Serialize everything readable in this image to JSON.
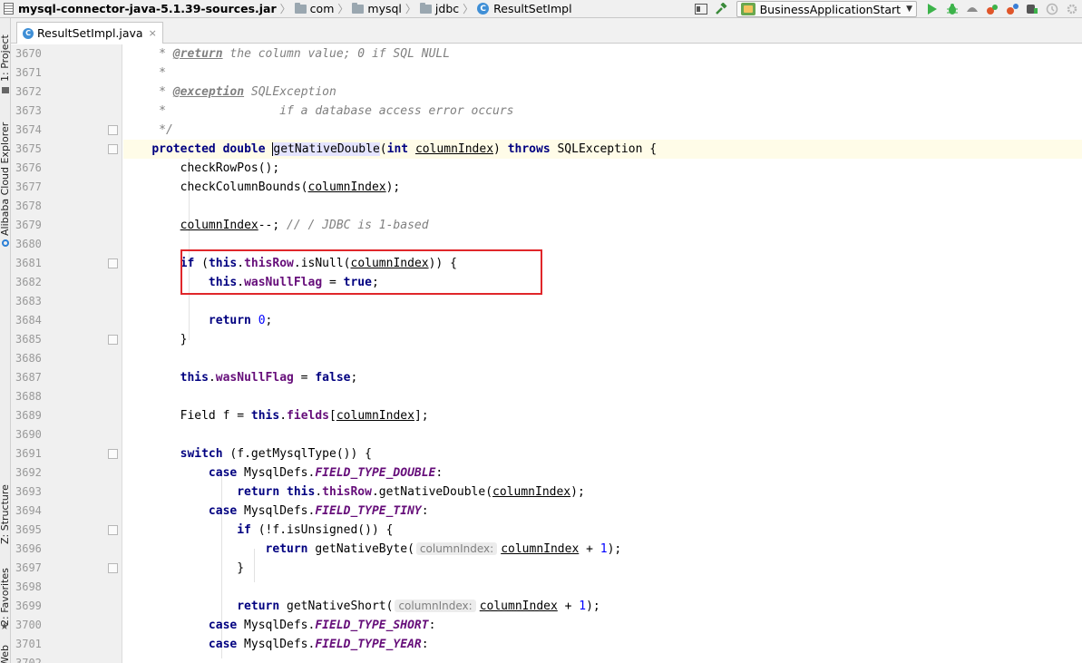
{
  "breadcrumb": {
    "jar": "mysql-connector-java-5.1.39-sources.jar",
    "folders": [
      "com",
      "mysql",
      "jdbc"
    ],
    "class_name": "ResultSetImpl"
  },
  "toolbar": {
    "run_config": "BusinessApplicationStart",
    "icons": [
      "layout-icon",
      "build-hammer-icon",
      "run-icon",
      "debug-icon",
      "coverage-icon",
      "profile-icon",
      "attach-icon",
      "stop-icon",
      "update-icon",
      "settings-icon"
    ]
  },
  "left_tool_windows": [
    "1: Project",
    "Alibaba Cloud Explorer",
    "Z: Structure",
    "2: Favorites",
    "Web"
  ],
  "editor": {
    "tab_label": "ResultSetImpl.java",
    "tab_close": "×",
    "line_numbers": [
      "3670",
      "3671",
      "3672",
      "3673",
      "3674",
      "3675",
      "3676",
      "3677",
      "3678",
      "3679",
      "3680",
      "3681",
      "3682",
      "3683",
      "3684",
      "3685",
      "3686",
      "3687",
      "3688",
      "3689",
      "3690",
      "3691",
      "3692",
      "3693",
      "3694",
      "3695",
      "3696",
      "3697",
      "3698",
      "3699",
      "3700",
      "3701",
      "3702"
    ],
    "code": {
      "l3670_star": "     * ",
      "l3670_tag": "@return",
      "l3670_rest": " the column value; 0 if SQL NULL",
      "l3671": "     *",
      "l3672_star": "     * ",
      "l3672_tag": "@exception",
      "l3672_type": " SQLException",
      "l3673": "     *                if a database access error occurs",
      "l3674": "     */",
      "l3675_kw1": "protected",
      "l3675_kw2": "double",
      "l3675_method": "getNativeDouble",
      "l3675_paren": "(",
      "l3675_kw3": "int",
      "l3675_param": "columnIndex",
      "l3675_close": ") ",
      "l3675_kw4": "throws",
      "l3675_rest": " SQLException {",
      "l3676": "checkRowPos();",
      "l3677_a": "checkColumnBounds(",
      "l3677_b": "columnIndex",
      "l3677_c": ");",
      "l3679_a": "columnIndex",
      "l3679_b": "--; ",
      "l3679_c": "// / JDBC is 1-based",
      "l3681_kw1": "if",
      "l3681_a": " (",
      "l3681_kw2": "this",
      "l3681_dot": ".",
      "l3681_field": "thisRow",
      "l3681_b": ".isNull(",
      "l3681_param": "columnIndex",
      "l3681_c": ")) {",
      "l3682_kw1": "this",
      "l3682_dot": ".",
      "l3682_field": "wasNullFlag",
      "l3682_a": " = ",
      "l3682_kw2": "true",
      "l3682_b": ";",
      "l3684_kw": "return",
      "l3684_num": "0",
      "l3684_b": ";",
      "l3685": "}",
      "l3687_kw1": "this",
      "l3687_dot": ".",
      "l3687_field": "wasNullFlag",
      "l3687_a": " = ",
      "l3687_kw2": "false",
      "l3687_b": ";",
      "l3689_a": "Field f = ",
      "l3689_kw": "this",
      "l3689_dot": ".",
      "l3689_field": "fields",
      "l3689_b": "[",
      "l3689_param": "columnIndex",
      "l3689_c": "];",
      "l3691_kw": "switch",
      "l3691_a": " (f.getMysqlType()) {",
      "l3692_kw": "case",
      "l3692_a": " MysqlDefs.",
      "l3692_const": "FIELD_TYPE_DOUBLE",
      "l3692_b": ":",
      "l3693_kw1": "return",
      "l3693_kw2": "this",
      "l3693_dot": ".",
      "l3693_field": "thisRow",
      "l3693_a": ".getNativeDouble(",
      "l3693_param": "columnIndex",
      "l3693_b": ");",
      "l3694_kw": "case",
      "l3694_a": " MysqlDefs.",
      "l3694_const": "FIELD_TYPE_TINY",
      "l3694_b": ":",
      "l3695_kw": "if",
      "l3695_a": " (!f.isUnsigned()) {",
      "l3696_kw": "return",
      "l3696_a": " getNativeByte(",
      "l3696_hint": "columnIndex:",
      "l3696_param": "columnIndex",
      "l3696_b": " + ",
      "l3696_num": "1",
      "l3696_c": ");",
      "l3697": "}",
      "l3699_kw": "return",
      "l3699_a": " getNativeShort(",
      "l3699_hint": "columnIndex:",
      "l3699_param": "columnIndex",
      "l3699_b": " + ",
      "l3699_num": "1",
      "l3699_c": ");",
      "l3700_kw": "case",
      "l3700_a": " MysqlDefs.",
      "l3700_const": "FIELD_TYPE_SHORT",
      "l3700_b": ":",
      "l3701_kw": "case",
      "l3701_a": " MysqlDefs.",
      "l3701_const": "FIELD_TYPE_YEAR",
      "l3701_b": ":"
    }
  },
  "colors": {
    "keyword": "#000080",
    "field": "#660e7a",
    "comment": "#808080",
    "number": "#0000ff",
    "highlight_box": "#e0262a",
    "current_line": "#fffce8"
  }
}
